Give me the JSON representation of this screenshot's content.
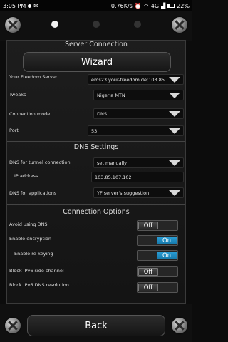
{
  "statusbar": {
    "time": "3:05 PM",
    "speed": "0.76K/s",
    "network": "4G",
    "battery": "22%"
  },
  "header": {
    "page_count": 3,
    "active_page": 1
  },
  "server_connection": {
    "title": "Server Connection",
    "wizard_label": "Wizard",
    "server_label": "Your Freedom Server",
    "server_value": "ems23.your-freedom.de;103.85",
    "tweaks_label": "Tweaks",
    "tweaks_value": "Nigeria MTN",
    "mode_label": "Connection mode",
    "mode_value": "DNS",
    "port_label": "Port",
    "port_value": "53"
  },
  "dns_settings": {
    "title": "DNS Settings",
    "tunnel_label": "DNS for tunnel connection",
    "tunnel_value": "set manually",
    "ip_label": "IP address",
    "ip_value": "103.85.107.102",
    "apps_label": "DNS for applications",
    "apps_value": "YF server's suggestion"
  },
  "connection_options": {
    "title": "Connection Options",
    "avoid_dns_label": "Avoid using DNS",
    "avoid_dns_state": "Off",
    "encryption_label": "Enable encryption",
    "encryption_state": "On",
    "rekey_label": "Enable re-keying",
    "rekey_state": "On",
    "ipv6_side_label": "Block IPv6 side channel",
    "ipv6_side_state": "Off",
    "ipv6_dns_label": "Block IPv6 DNS resolution",
    "ipv6_dns_state": "Off"
  },
  "footer": {
    "back_label": "Back"
  },
  "colors": {
    "toggle_on": "#1a8cc4",
    "background": "#0c0c0c"
  }
}
